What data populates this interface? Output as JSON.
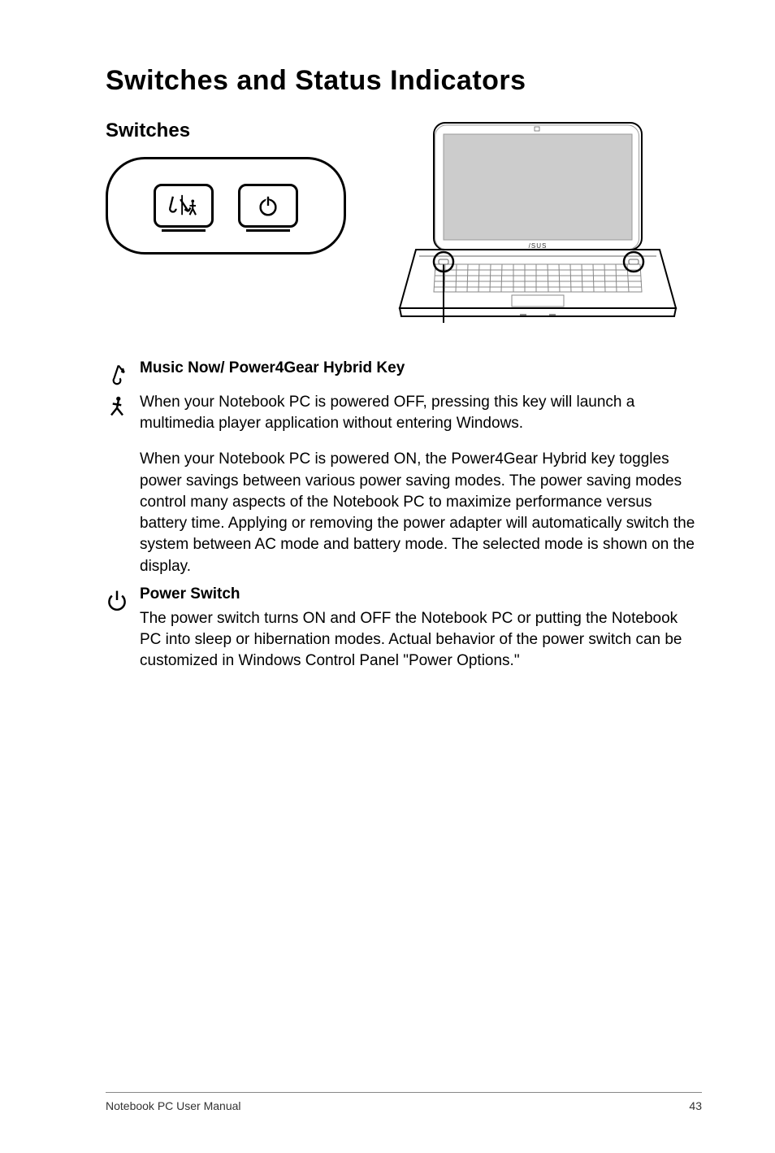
{
  "title": "Switches and Status Indicators",
  "section_heading": "Switches",
  "music_key": {
    "title": "Music Now/ Power4Gear Hybrid Key",
    "para1": "When your Notebook PC is powered OFF, pressing this key will launch a multimedia player application without entering Windows.",
    "para2": "When your Notebook PC is powered ON, the Power4Gear Hybrid key toggles power savings between various power saving modes. The power saving modes control many aspects of the Notebook PC to maximize performance versus battery time. Applying or removing the power adapter will automatically switch the system between AC mode and battery mode. The selected mode is shown on the display."
  },
  "power_switch": {
    "title": "Power Switch",
    "para": "The power switch turns ON and OFF the Notebook PC or putting the Notebook PC into sleep or hibernation modes. Actual behavior of the power switch can be customized in Windows Control Panel \"Power Options.\""
  },
  "footer": {
    "left": "Notebook PC User Manual",
    "right": "43"
  }
}
